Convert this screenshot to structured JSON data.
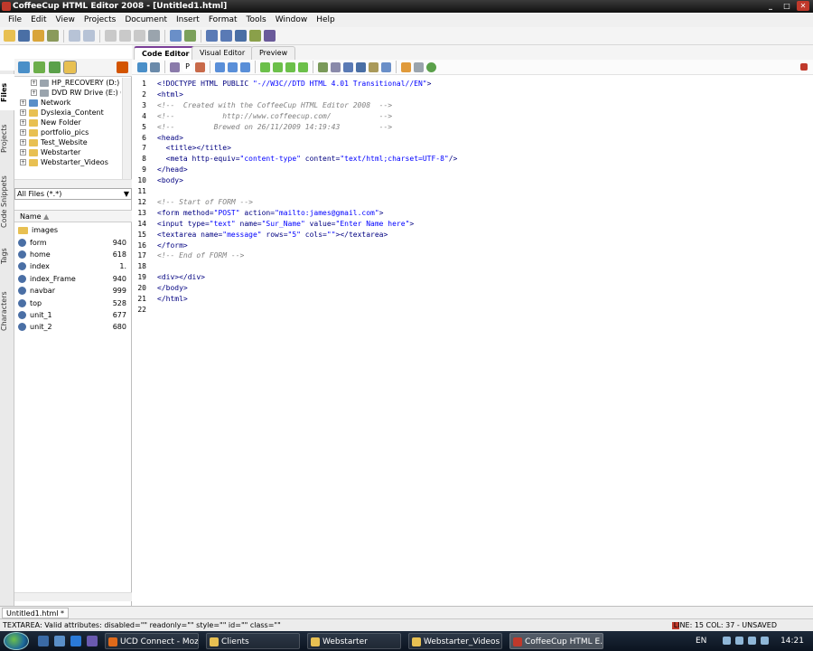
{
  "window": {
    "title": "CoffeeCup HTML Editor 2008 - [Untitled1.html]",
    "min": "_",
    "max": "□",
    "close": "✕"
  },
  "menu": [
    "File",
    "Edit",
    "View",
    "Projects",
    "Document",
    "Insert",
    "Format",
    "Tools",
    "Window",
    "Help"
  ],
  "side_tabs": [
    "Files",
    "Projects",
    "Code Snippets",
    "Tags",
    "Characters"
  ],
  "tree": [
    {
      "label": "HP_RECOVERY (D:)",
      "type": "drive",
      "indent": 2
    },
    {
      "label": "DVD RW Drive (E:) G",
      "type": "drive",
      "indent": 2
    },
    {
      "label": "Network",
      "type": "net",
      "indent": 1
    },
    {
      "label": "Dyslexia_Content",
      "type": "folder",
      "indent": 1
    },
    {
      "label": "New Folder",
      "type": "folder",
      "indent": 1
    },
    {
      "label": "portfolio_pics",
      "type": "folder",
      "indent": 1
    },
    {
      "label": "Test_Website",
      "type": "folder",
      "indent": 1
    },
    {
      "label": "Webstarter",
      "type": "folder",
      "indent": 1
    },
    {
      "label": "Webstarter_Videos",
      "type": "folder",
      "indent": 1
    }
  ],
  "filter": {
    "value": "All Files (*.*)"
  },
  "file_list": {
    "header": "Name",
    "files": [
      {
        "name": "images",
        "size": "",
        "folder": true
      },
      {
        "name": "form",
        "size": "940"
      },
      {
        "name": "home",
        "size": "618"
      },
      {
        "name": "index",
        "size": "1."
      },
      {
        "name": "index_Frame",
        "size": "940"
      },
      {
        "name": "navbar",
        "size": "999"
      },
      {
        "name": "top",
        "size": "528"
      },
      {
        "name": "unit_1",
        "size": "677"
      },
      {
        "name": "unit_2",
        "size": "680"
      }
    ]
  },
  "editor_tabs": [
    "Code Editor",
    "Visual Editor",
    "Preview"
  ],
  "code_lines": [
    "<!DOCTYPE HTML PUBLIC \"-//W3C//DTD HTML 4.01 Transitional//EN\">",
    "<html>",
    "<!--  Created with the CoffeeCup HTML Editor 2008  -->",
    "<!--           http://www.coffeecup.com/           -->",
    "<!--         Brewed on 26/11/2009 14:19:43         -->",
    "<head>",
    "  <title></title>",
    "  <meta http-equiv=\"content-type\" content=\"text/html;charset=UTF-8\"/>",
    "</head>",
    "<body>",
    "",
    "<!-- Start of FORM -->",
    "<form method=\"POST\" action=\"mailto:james@gmail.com\">",
    "<input type=\"text\" name=\"Sur_Name\" value=\"Enter Name here\">",
    "<textarea name=\"message\" rows=\"5\" cols=\"\"></textarea>",
    "</form>",
    "<!-- End of FORM -->",
    "",
    "<div></div>",
    "</body>",
    "</html>",
    ""
  ],
  "document_tab": "Untitled1.html *",
  "status": {
    "hint": "TEXTAREA: Valid attributes: disabled=\"\" readonly=\"\" style=\"\" id=\"\" class=\"\"",
    "position": "LINE: 15  COL: 37 - UNSAVED"
  },
  "taskbar": {
    "items": [
      {
        "label": "UCD Connect - Moz...",
        "color": "#e06a1a"
      },
      {
        "label": "Clients",
        "color": "#e8c052"
      },
      {
        "label": "Webstarter",
        "color": "#e8c052"
      },
      {
        "label": "Webstarter_Videos",
        "color": "#e8c052"
      },
      {
        "label": "CoffeeCup HTML E...",
        "color": "#c0392b",
        "active": true
      }
    ],
    "lang": "EN",
    "clock": "14:21"
  },
  "colors": {
    "accent": "#7a3e98",
    "tag": "#000080",
    "value": "#0000ff",
    "comment": "#808080"
  }
}
